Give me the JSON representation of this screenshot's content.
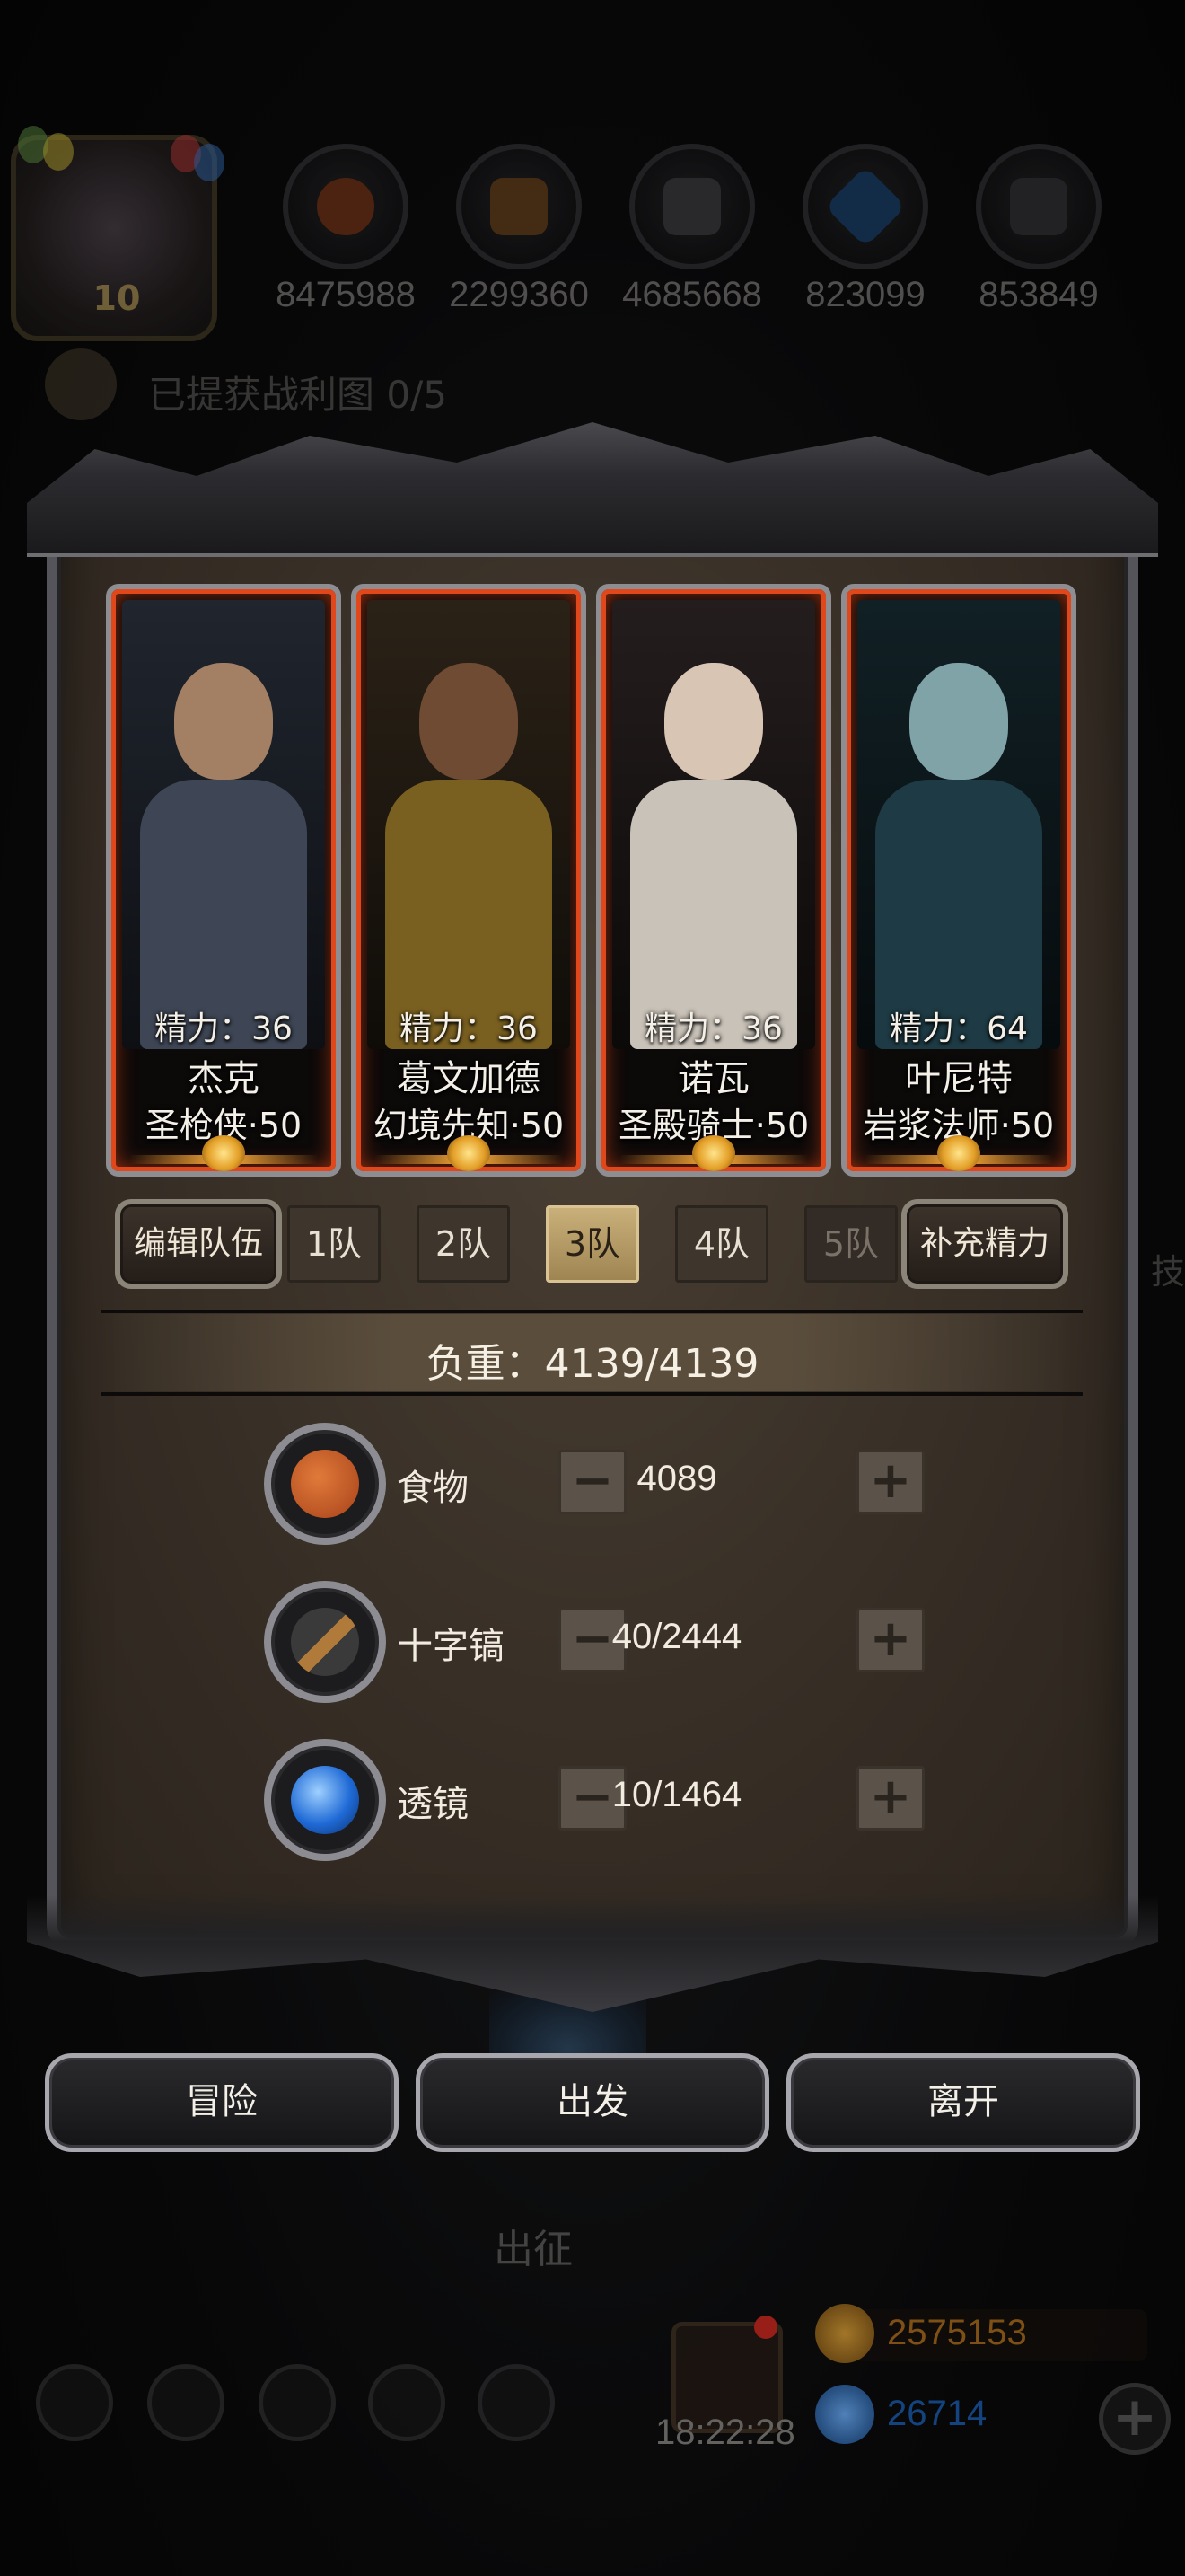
{
  "resources": [
    {
      "icon": "meat-icon",
      "value": "8475988"
    },
    {
      "icon": "wood-icon",
      "value": "2299360"
    },
    {
      "icon": "iron-icon",
      "value": "4685668"
    },
    {
      "icon": "crystal-icon",
      "value": "823099"
    },
    {
      "icon": "stone-icon",
      "value": "853849"
    }
  ],
  "player": {
    "level": "10"
  },
  "quest": {
    "text": "已提获战利图 0/5"
  },
  "side_hint": "技",
  "heroes": [
    {
      "stamina": "精力：36",
      "name": "杰克",
      "class": "圣枪侠·50",
      "palette": {
        "bg": "#20252e",
        "head": "#a38063",
        "body": "#3e4655"
      }
    },
    {
      "stamina": "精力：36",
      "name": "葛文加德",
      "class": "幻境先知·50",
      "palette": {
        "bg": "#2b2217",
        "head": "#6f4b33",
        "body": "#7a6020"
      }
    },
    {
      "stamina": "精力：36",
      "name": "诺瓦",
      "class": "圣殿骑士·50",
      "palette": {
        "bg": "#241d1d",
        "head": "#d9c5b3",
        "body": "#c9c2b8"
      }
    },
    {
      "stamina": "精力：64",
      "name": "叶尼特",
      "class": "岩浆法师·50",
      "palette": {
        "bg": "#112025",
        "head": "#7fa3a6",
        "body": "#1e3a44"
      }
    }
  ],
  "team": {
    "edit_label": "编辑队伍",
    "tabs": [
      "1队",
      "2队",
      "3队",
      "4队",
      "5队"
    ],
    "active_tab": "3队",
    "disabled_tab": "5队",
    "refill_label": "补充精力"
  },
  "load": {
    "text": "负重：4139/4139"
  },
  "items": [
    {
      "icon": "meat-icon",
      "name": "食物",
      "qty": "4089",
      "color": "#c25522"
    },
    {
      "icon": "pickaxe-icon",
      "name": "十字镐",
      "qty": "40/2444",
      "color": "#8a6a3a"
    },
    {
      "icon": "lens-icon",
      "name": "透镜",
      "qty": "10/1464",
      "color": "#1f6ad6"
    }
  ],
  "stepper": {
    "minus": "−",
    "plus": "+"
  },
  "actions": {
    "adventure": "冒险",
    "depart": "出发",
    "leave": "离开"
  },
  "background": {
    "dispatch_label": "出征",
    "timer": "18:22:28",
    "gold": "2575153",
    "gems": "26714",
    "gold_color": "#b0701f",
    "gem_color": "#1d5fb0",
    "plus": "+"
  }
}
